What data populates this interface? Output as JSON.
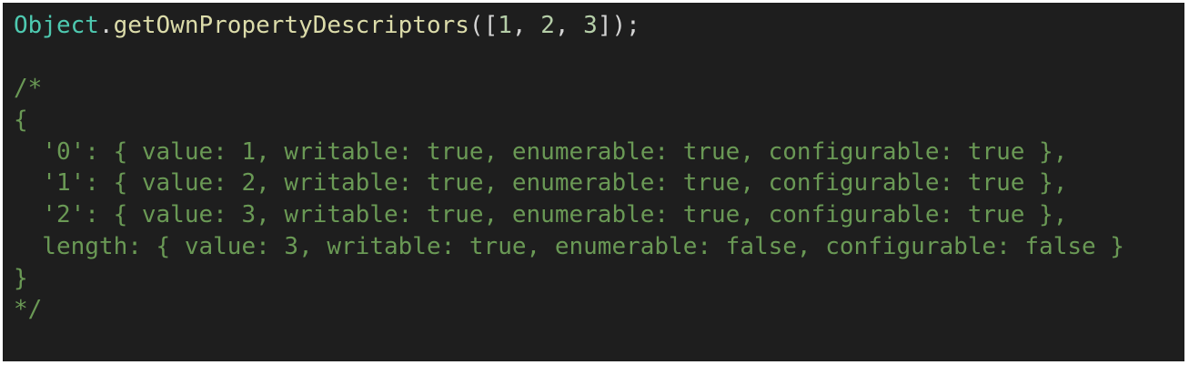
{
  "code": {
    "call": {
      "object": "Object",
      "dot": ".",
      "method": "getOwnPropertyDescriptors",
      "open": "([",
      "n1": "1",
      "sep1": ", ",
      "n2": "2",
      "sep2": ", ",
      "n3": "3",
      "close": "]);"
    },
    "comment_lines": [
      "/*",
      "{",
      "  '0': { value: 1, writable: true, enumerable: true, configurable: true },",
      "  '1': { value: 2, writable: true, enumerable: true, configurable: true },",
      "  '2': { value: 3, writable: true, enumerable: true, configurable: true },",
      "  length: { value: 3, writable: true, enumerable: false, configurable: false }",
      "}",
      "*/"
    ]
  },
  "colors": {
    "background": "#1e1e1e",
    "class": "#4ec9b0",
    "function": "#dcdcaa",
    "number": "#b5cea8",
    "comment": "#6a9955",
    "punctuation": "#d4d4d4"
  }
}
